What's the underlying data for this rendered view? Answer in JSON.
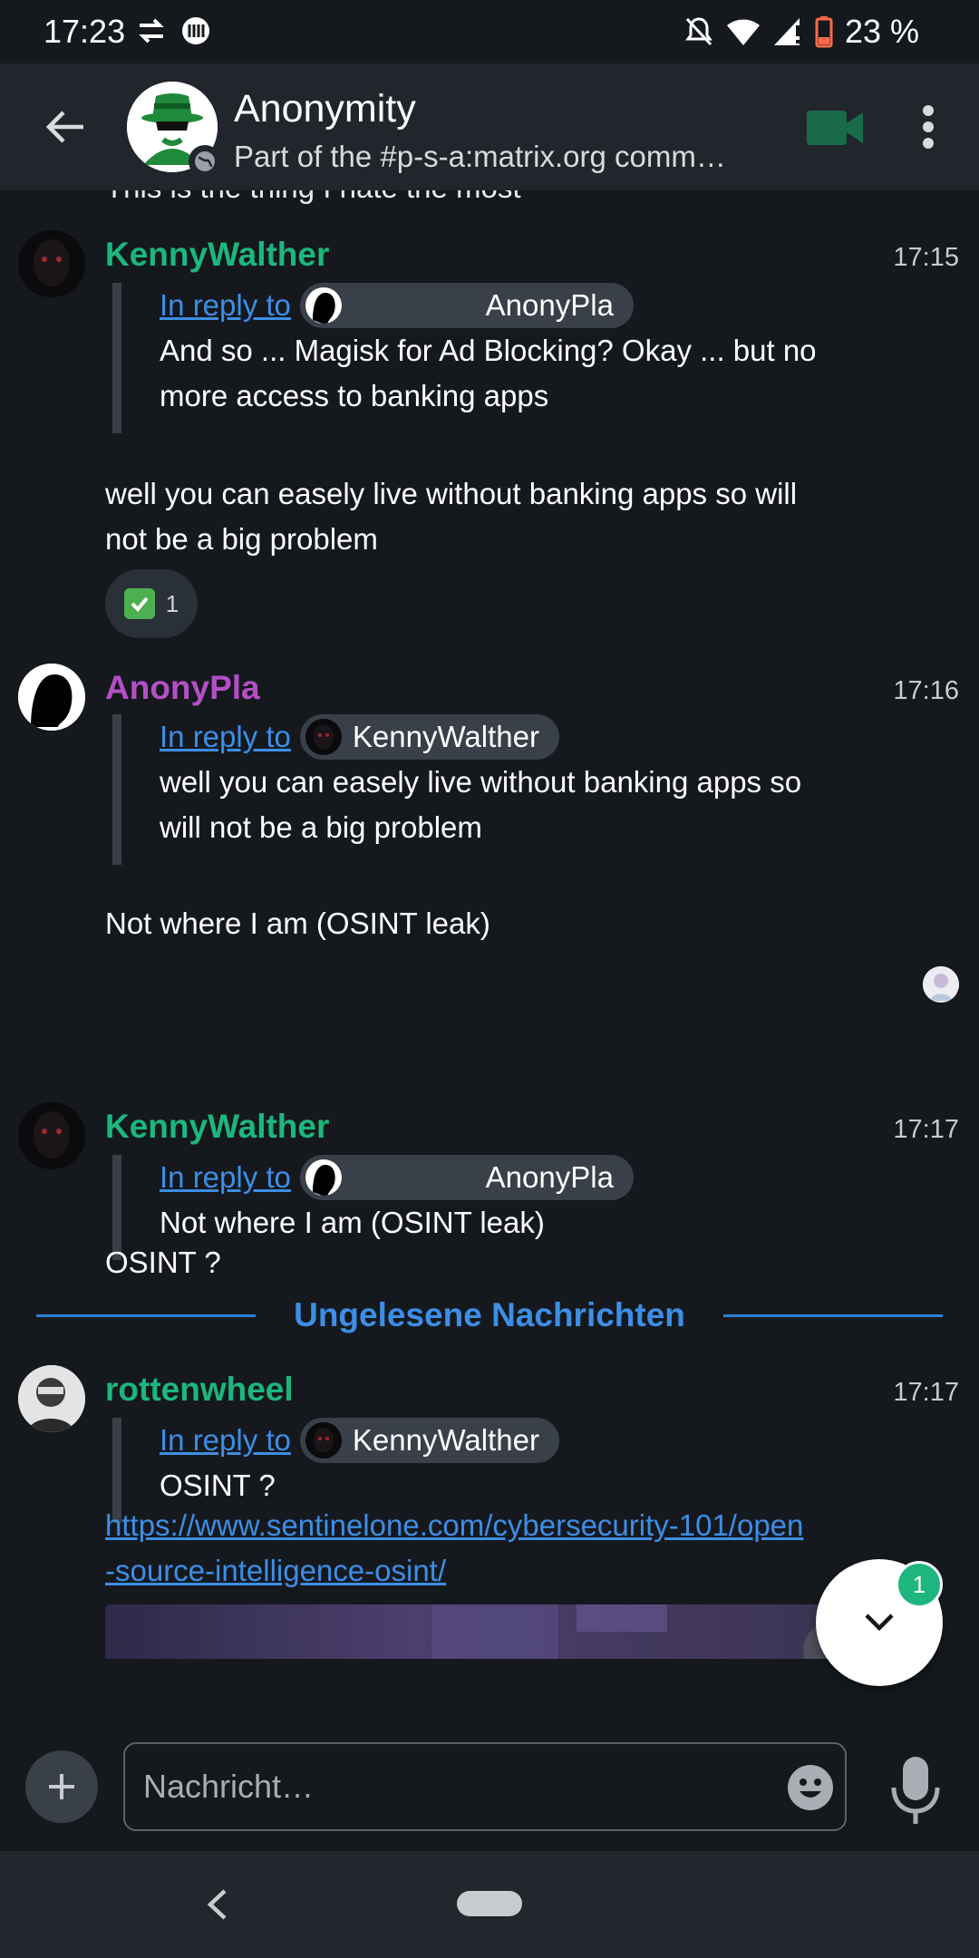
{
  "status": {
    "time": "17:23",
    "battery": "23 %"
  },
  "header": {
    "title": "Anonymity",
    "subtitle": "Part of the #p-s-a:matrix.org comm…"
  },
  "timeline": {
    "clipped_text": "This is the thing I hate the most",
    "messages": [
      {
        "sender": "KennyWalther",
        "time": "17:15",
        "reply_link": "In reply to",
        "reply_user": "AnonyPla",
        "reply_text_1": "And so ... Magisk for Ad Blocking? Okay ... but no",
        "reply_text_2": "more access to banking apps",
        "body_1": "well you can easely live without banking apps so will",
        "body_2": "not be a big problem",
        "reaction_count": "1"
      },
      {
        "sender": "AnonyPla",
        "time": "17:16",
        "reply_link": "In reply to",
        "reply_user": "KennyWalther",
        "reply_text_1": "well you can easely live without banking apps so",
        "reply_text_2": "will not be a big problem",
        "body_1": "Not where I am (OSINT leak)"
      },
      {
        "sender": "KennyWalther",
        "time": "17:17",
        "reply_link": "In reply to",
        "reply_user": "AnonyPla",
        "reply_text_1": "Not where I am (OSINT leak)",
        "body_1": "OSINT ?"
      },
      {
        "sender": "rottenwheel",
        "time": "17:17",
        "reply_link": "In reply to",
        "reply_user": "KennyWalther",
        "reply_text_1": "OSINT ?",
        "link_1": "https://www.sentinelone.com/cybersecurity-101/open",
        "link_2": "-source-intelligence-osint/"
      }
    ],
    "unread_divider": "Ungelesene Nachrichten"
  },
  "scroll_fab": {
    "badge": "1"
  },
  "composer": {
    "placeholder": "Nachricht…"
  },
  "colors": {
    "green_sender": "#1db67f",
    "purple_sender": "#b44fc5",
    "link": "#3d8ee6",
    "background": "#15191e"
  }
}
